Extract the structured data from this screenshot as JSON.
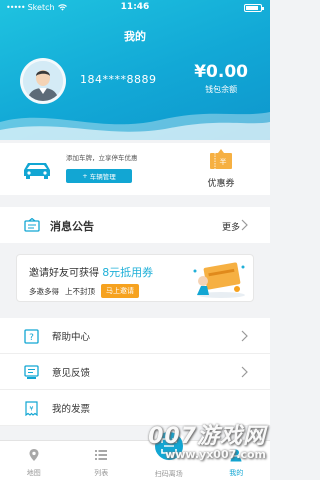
{
  "status_bar": {
    "carrier": "Sketch",
    "time": "11:46"
  },
  "header": {
    "title": "我的",
    "phone": "184****8889",
    "balance": "¥0.00",
    "balance_label": "钱包余额"
  },
  "car_card": {
    "hint": "添加车牌，立享停车优惠",
    "button_label": "车辆管理",
    "coupon_icon_text": "半",
    "coupon_label": "优惠券"
  },
  "notice": {
    "title": "消息公告",
    "more": "更多"
  },
  "invite": {
    "line1_prefix": "邀请好友可获得",
    "line1_highlight": "8元抵用券",
    "line2_a": "多邀多得",
    "line2_b": "上不封顶",
    "button_label": "马上邀请"
  },
  "menu": {
    "items": [
      {
        "label": "帮助中心"
      },
      {
        "label": "意见反馈"
      },
      {
        "label": "我的发票"
      }
    ]
  },
  "tabbar": {
    "items": [
      {
        "label": "地图"
      },
      {
        "label": "列表"
      },
      {
        "label": "扫码离场"
      },
      {
        "label": "我的"
      }
    ]
  },
  "watermark": {
    "main": "007游戏网",
    "url": "www.yx007.com"
  },
  "colors": {
    "accent": "#12a6d3",
    "orange": "#f6a21f",
    "highlight": "#20b0d8"
  }
}
